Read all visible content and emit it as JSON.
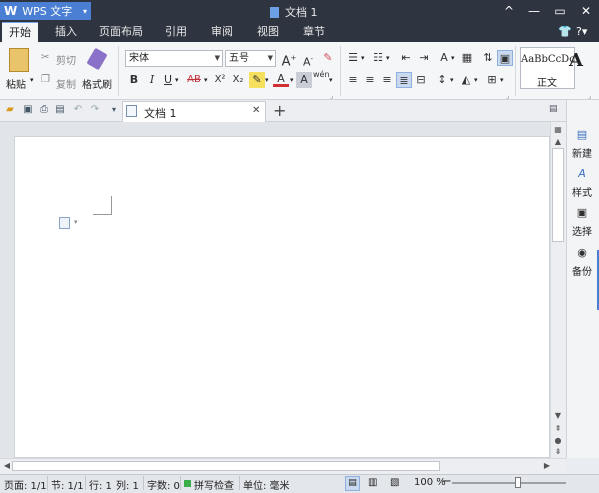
{
  "app": {
    "logo_letter": "W",
    "name": "WPS 文字",
    "caret": "▾"
  },
  "window": {
    "title": "文档 1",
    "minimize": "^",
    "restore": "—",
    "maximize": "▭",
    "close": "✕",
    "skin": "👕",
    "help": "?▾"
  },
  "menu_tabs": [
    "开始",
    "插入",
    "页面布局",
    "引用",
    "审阅",
    "视图",
    "章节"
  ],
  "ribbon": {
    "paste": "粘贴",
    "cut": "剪切",
    "copy": "复制",
    "format_painter": "格式刷",
    "font_name": "宋体",
    "font_size": "五号",
    "bold": "B",
    "italic": "I",
    "underline": "U",
    "strike": "AB",
    "superscript": "X²",
    "subscript": "X₂",
    "font_color": "A",
    "char_shade": "A",
    "pinyin": "wén",
    "style_sample": "AaBbCcDc",
    "style_big": "A",
    "style_name": "正文"
  },
  "doc_tab": {
    "label": "文档 1",
    "close": "✕",
    "add": "+"
  },
  "sidebar": [
    {
      "label": "新建",
      "icon": "new-doc-icon",
      "glyph": "▤"
    },
    {
      "label": "样式",
      "icon": "style-icon",
      "glyph": "A"
    },
    {
      "label": "选择",
      "icon": "select-icon",
      "glyph": "▣"
    },
    {
      "label": "备份",
      "icon": "backup-icon",
      "glyph": "◉"
    }
  ],
  "status": {
    "page": "页面: 1/1",
    "section": "节: 1/1",
    "line": "行: 1",
    "column": "列: 1",
    "word_count": "字数: 0",
    "spell_check": "拼写检查",
    "unit": "单位: 毫米",
    "zoom": "100 %",
    "zoom_out": "−",
    "zoom_in": "+",
    "zoom_level": 1.0
  },
  "colors": {
    "titlebar": "#2f3540",
    "accent": "#4a7fd3",
    "page": "#ffffff"
  }
}
